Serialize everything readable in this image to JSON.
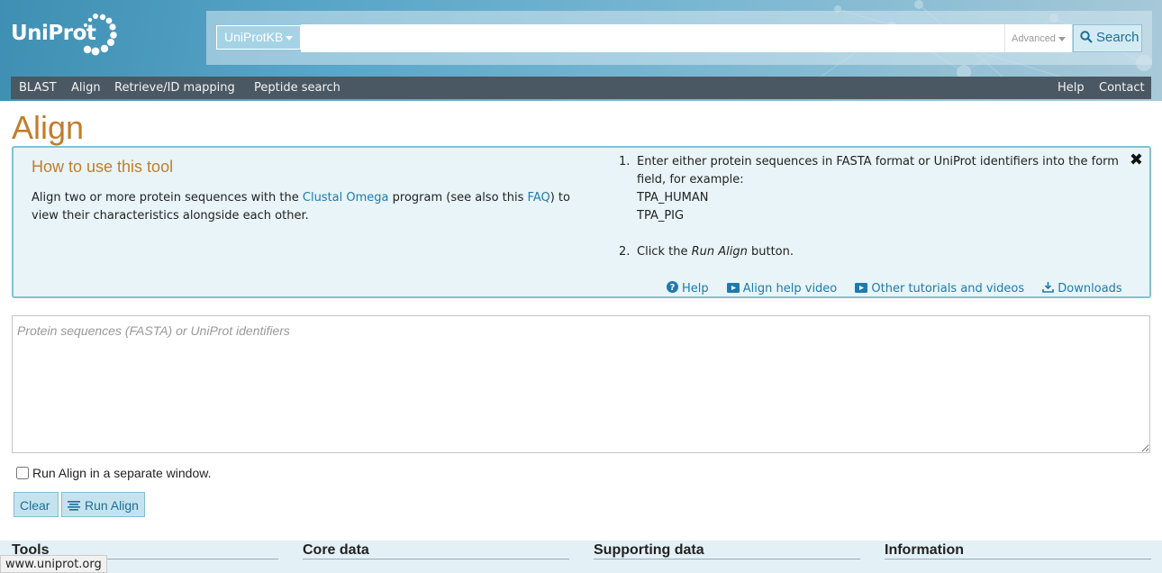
{
  "header": {
    "logo_text": "UniProt",
    "db_select": "UniProtKB",
    "search_placeholder": "",
    "advanced_label": "Advanced",
    "search_button": "Search"
  },
  "nav": {
    "left": [
      "BLAST",
      "Align",
      "Retrieve/ID mapping",
      "Peptide search"
    ],
    "right": [
      "Help",
      "Contact"
    ]
  },
  "page": {
    "title": "Align"
  },
  "howto": {
    "title": "How to use this tool",
    "desc_prefix": "Align two or more protein sequences with the ",
    "clustal_link": "Clustal Omega",
    "desc_mid": " program (see also this ",
    "faq_link": "FAQ",
    "desc_suffix": ") to view their characteristics alongside each other.",
    "step1_num": "1.",
    "step1_text": "Enter either protein sequences in FASTA format or UniProt identifiers into the form field, for example:",
    "example1": "TPA_HUMAN",
    "example2": "TPA_PIG",
    "step2_num": "2.",
    "step2_prefix": "Click the ",
    "step2_em": "Run Align",
    "step2_suffix": " button.",
    "links": {
      "help": "Help",
      "video": "Align help video",
      "tutorials": "Other tutorials and videos",
      "downloads": "Downloads"
    }
  },
  "form": {
    "sequence_placeholder": "Protein sequences (FASTA) or UniProt identifiers",
    "separate_window_label": "Run Align in a separate window.",
    "clear_button": "Clear",
    "run_button": "Run Align"
  },
  "footer": {
    "columns": [
      "Tools",
      "Core data",
      "Supporting data",
      "Information"
    ]
  },
  "status_bar_url": "www.uniprot.org",
  "colors": {
    "accent_orange": "#c17d2c",
    "link_blue": "#1e7aad",
    "nav_bg": "#4a5863"
  }
}
